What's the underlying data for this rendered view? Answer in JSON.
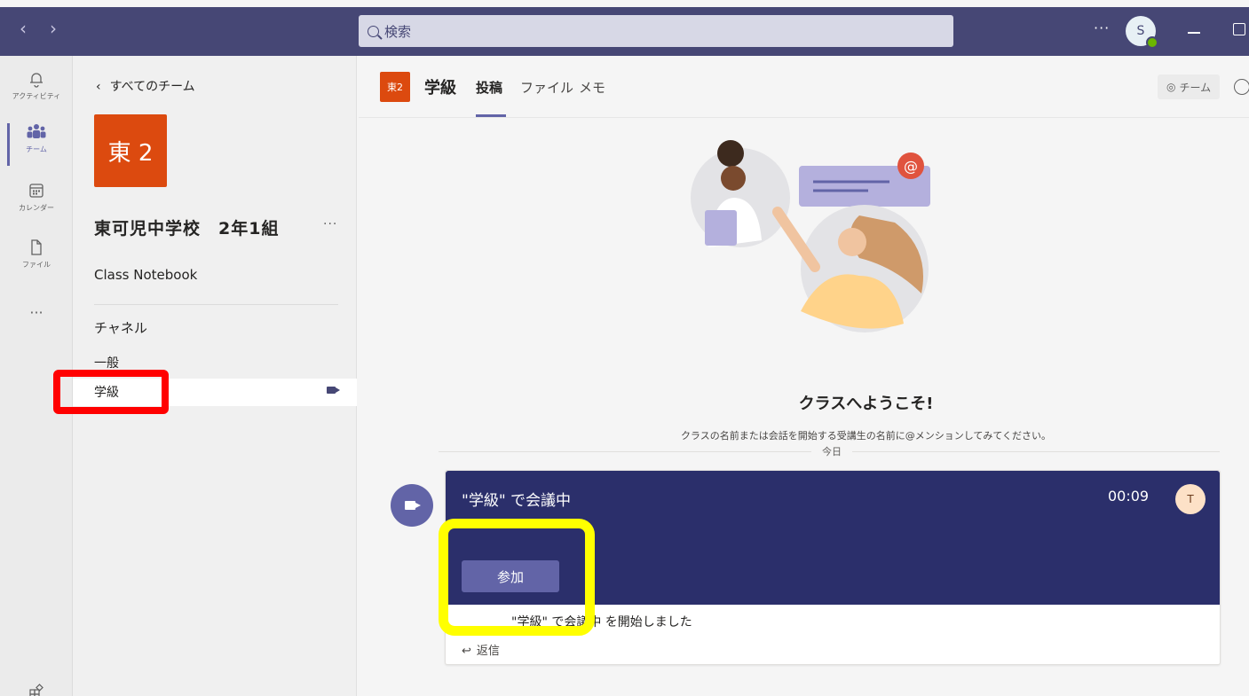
{
  "titlebar": {
    "back_glyph": "‹",
    "forward_glyph": "›",
    "search_placeholder": "検索",
    "more": "···",
    "user_avatar_initial": "S"
  },
  "rail": {
    "items": [
      {
        "label": "アクティビティ",
        "icon": "bell-icon"
      },
      {
        "label": "チーム",
        "icon": "teams-icon"
      },
      {
        "label": "カレンダー",
        "icon": "calendar-icon"
      },
      {
        "label": "ファイル",
        "icon": "file-icon"
      }
    ],
    "more": "···"
  },
  "pane": {
    "back_link": "すべてのチーム",
    "team_badge": "東 2",
    "team_name": "東可児中学校　2年1組",
    "team_more": "···",
    "notebook": "Class Notebook",
    "channels_heading": "チャネル",
    "channels": [
      {
        "name": "一般"
      },
      {
        "name": "学級",
        "active": true
      }
    ]
  },
  "header": {
    "badge": "東2",
    "channel_name": "学級",
    "tabs": [
      "投稿",
      "ファイル",
      "メモ"
    ],
    "active_tab": "投稿",
    "team_button": "チーム"
  },
  "welcome": {
    "title": "クラスへようこそ!",
    "subtitle": "クラスの名前または会話を開始する受講生の名前に@メンションしてみてください。",
    "today": "今日"
  },
  "meeting": {
    "title": "\"学級\" で会議中",
    "elapsed": "00:09",
    "participant_initial": "T",
    "join_label": "参加",
    "started_text": "\"学級\" で会議中 を開始しました",
    "reply_label": "返信"
  },
  "colors": {
    "titlebar": "#464775",
    "accent": "#6264a7",
    "team_orange": "#dc4a0f",
    "meeting_banner": "#2b2f6b",
    "highlight_red": "#ff0000",
    "highlight_yellow": "#ffff00"
  }
}
